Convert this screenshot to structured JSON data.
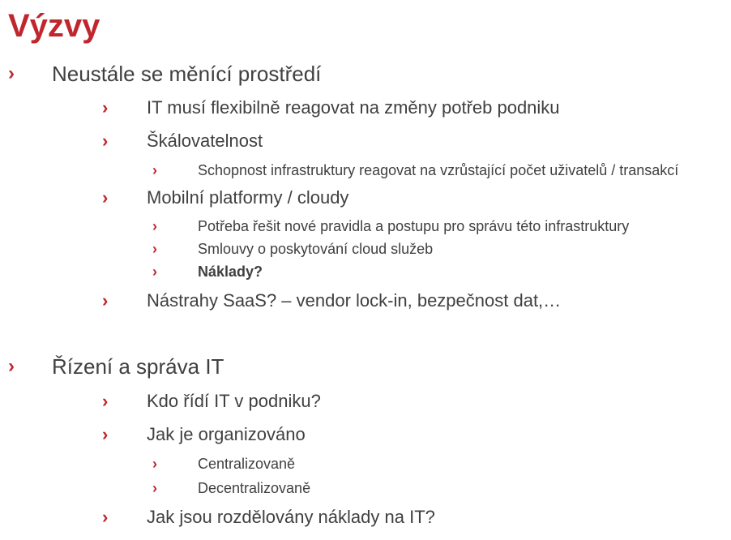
{
  "slide": {
    "title": "Výzvy",
    "items": [
      {
        "text": "Neustále se měnící prostředí"
      },
      {
        "text": "IT musí flexibilně reagovat na změny potřeb podniku"
      },
      {
        "text": "Škálovatelnost"
      },
      {
        "text": "Schopnost infrastruktury reagovat na vzrůstající počet uživatelů / transakcí"
      },
      {
        "text": "Mobilní platformy / cloudy"
      },
      {
        "text": "Potřeba řešit nové pravidla a postupu pro správu této infrastruktury"
      },
      {
        "text": "Smlouvy o poskytování cloud služeb"
      },
      {
        "text": "Náklady?"
      },
      {
        "text": "Nástrahy SaaS? – vendor lock-in, bezpečnost dat,…"
      },
      {
        "text": "Řízení a správa IT"
      },
      {
        "text": "Kdo řídí IT v podniku?"
      },
      {
        "text": "Jak je organizováno"
      },
      {
        "text": "Centralizovaně"
      },
      {
        "text": "Decentralizovaně"
      },
      {
        "text": "Jak jsou rozdělovány náklady na IT?"
      }
    ]
  },
  "colors": {
    "accent": "#c0262d",
    "text": "#404040"
  },
  "icons": {
    "bullet": "chevron-right-icon"
  }
}
